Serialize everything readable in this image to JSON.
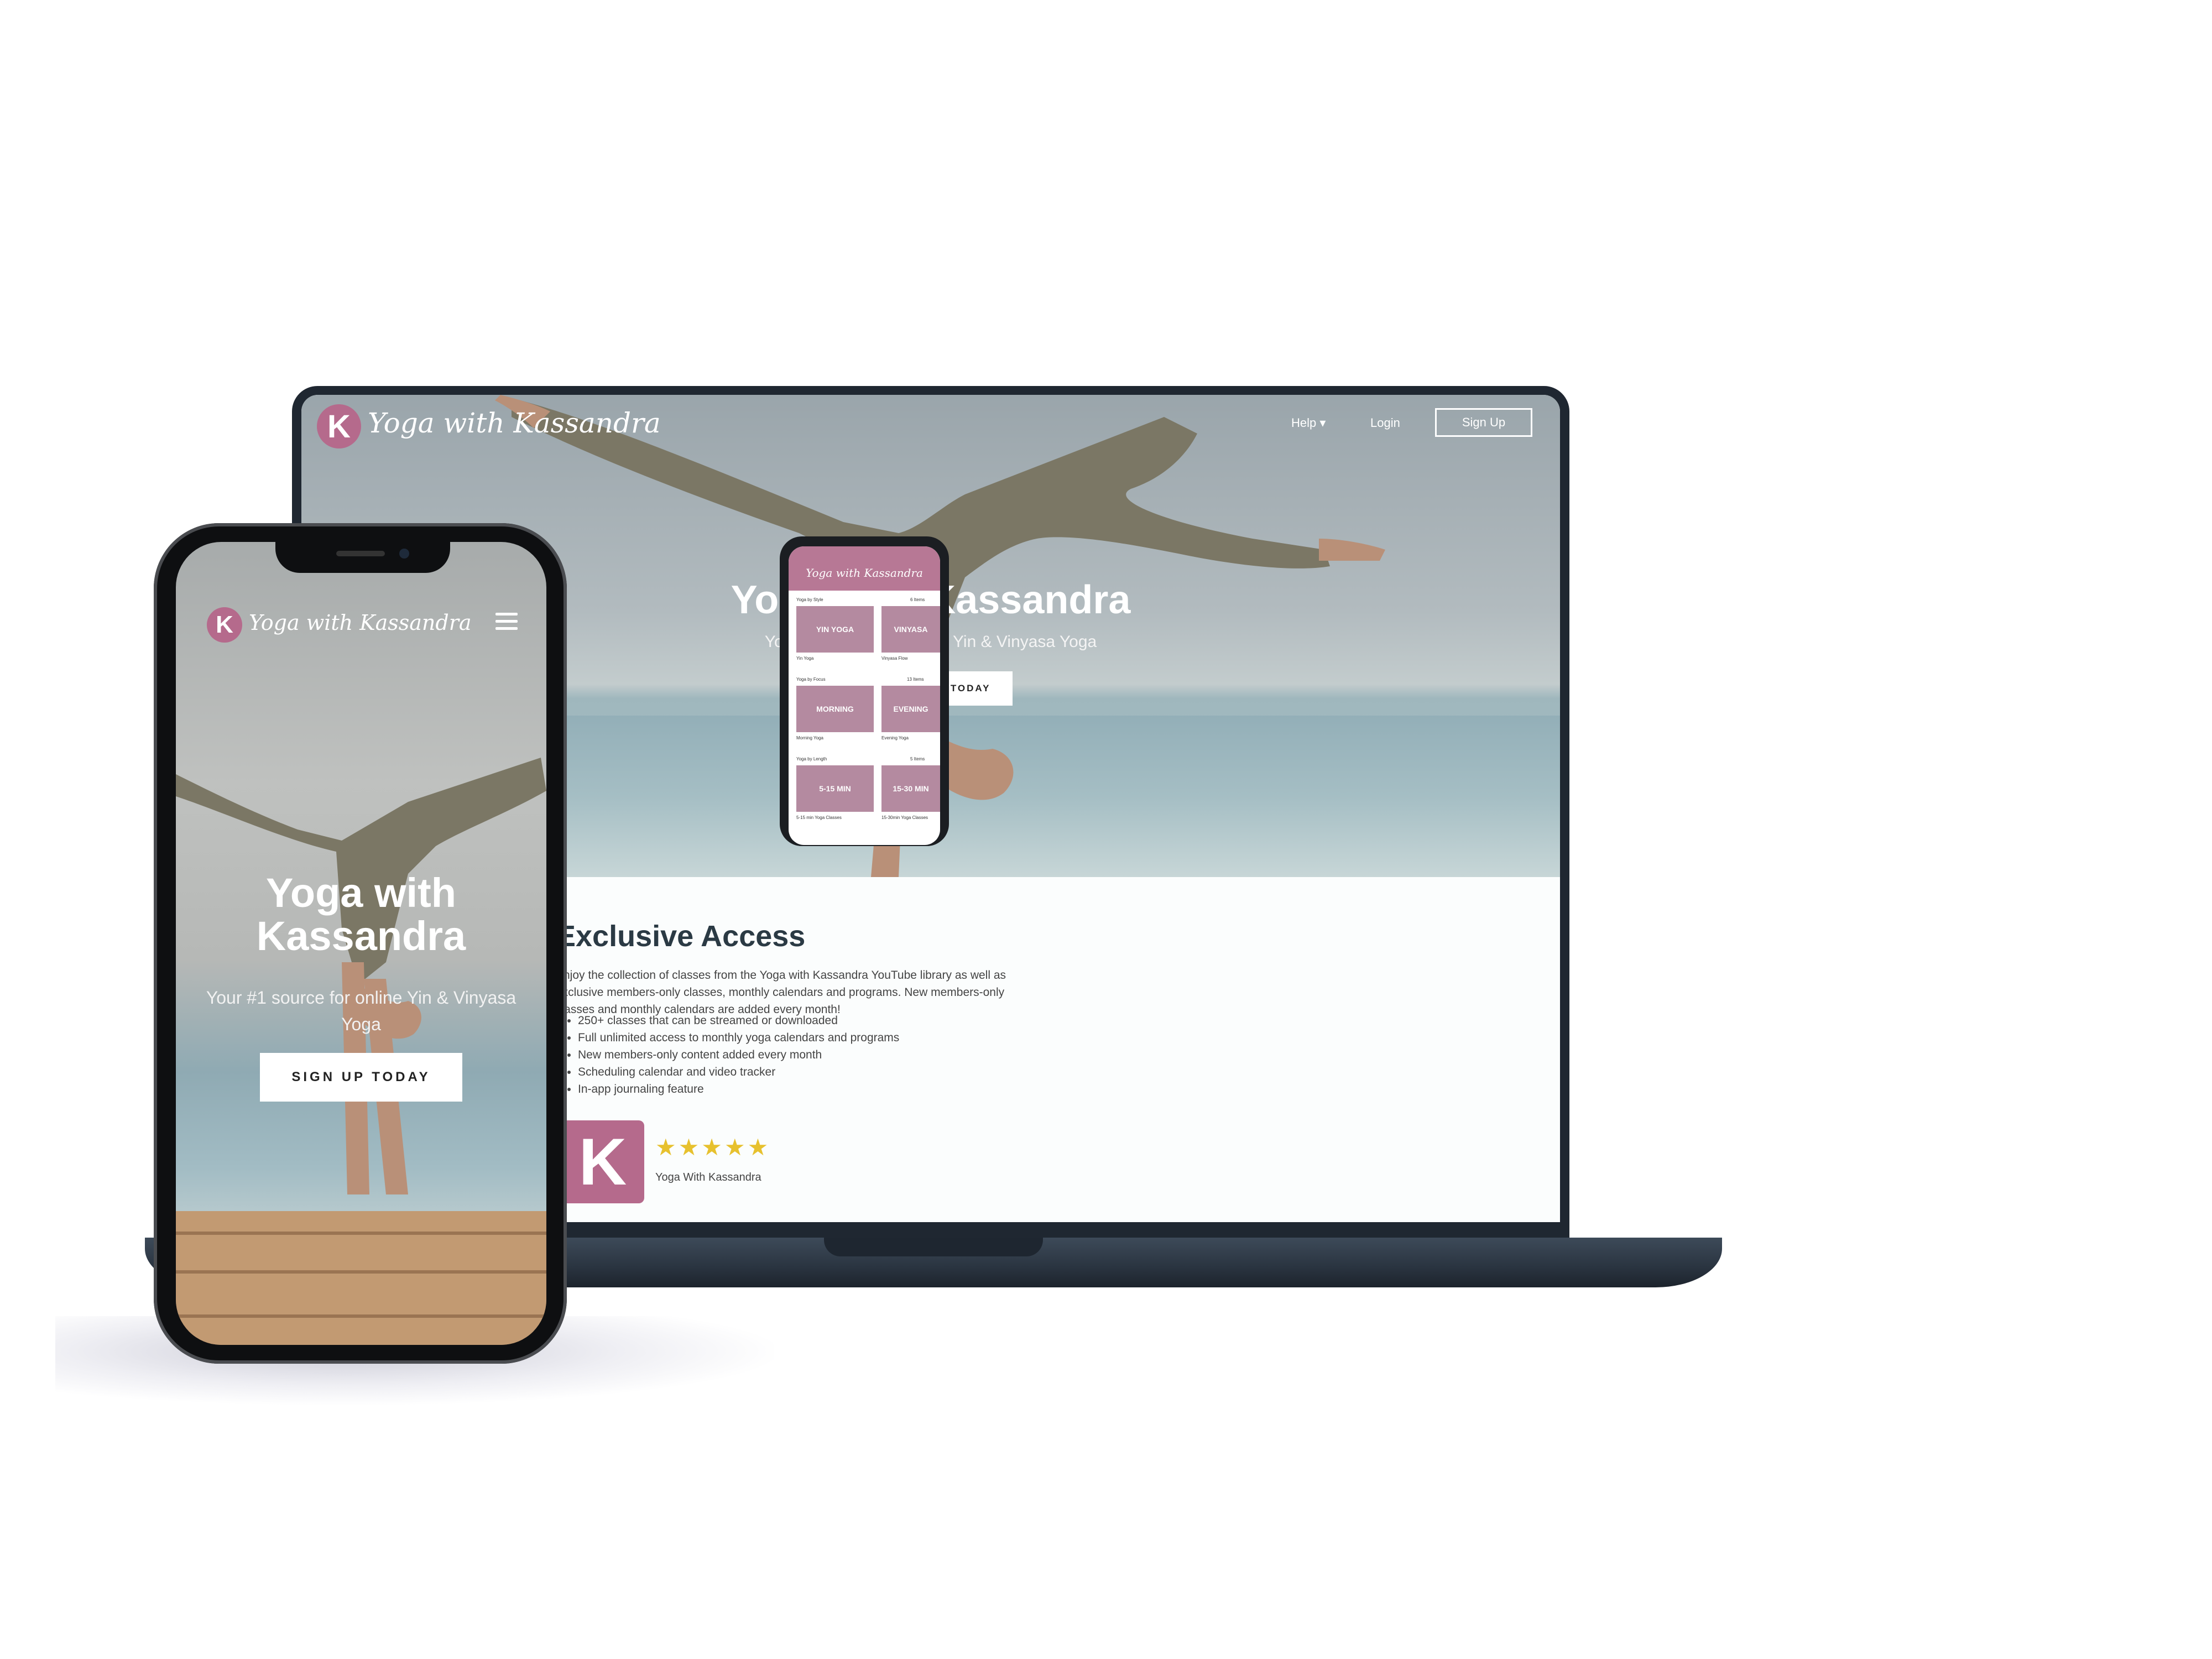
{
  "brand": {
    "logo_letter": "K",
    "name_script": "Yoga with Kassandra",
    "accent_color": "#b56a8c",
    "star_color": "#e7c12e"
  },
  "laptop": {
    "nav": {
      "help": "Help ▾",
      "login": "Login",
      "signup": "Sign Up"
    },
    "hero": {
      "title": "Yoga with Kassandra",
      "subtitle": "Your #1 source for online Yin & Vinyasa Yoga",
      "cta": "SIGN UP TODAY"
    },
    "section": {
      "title": "Exclusive Access",
      "body": "Enjoy the collection of classes from the Yoga with Kassandra YouTube library as well as exclusive members-only classes, monthly calendars and programs. New members-only classes and monthly calendars are added every month!",
      "features": [
        "250+ classes that can be streamed or downloaded",
        "Full unlimited access to monthly yoga calendars and programs",
        "New members-only content added every month",
        "Scheduling calendar and video tracker",
        "In-app journaling feature"
      ],
      "app_stars": "★★★★★",
      "app_name": "Yoga With Kassandra"
    },
    "mini_app": {
      "title": "Yoga with Kassandra",
      "groups": [
        {
          "label": "Yoga by Style",
          "count": "6 Items",
          "thumbs": [
            "YIN YOGA",
            "VINYASA"
          ],
          "captions": [
            "Yin Yoga",
            "Vinyasa Flow"
          ]
        },
        {
          "label": "Yoga by Focus",
          "count": "13 Items",
          "thumbs": [
            "MORNING",
            "EVENING"
          ],
          "captions": [
            "Morning Yoga",
            "Evening Yoga"
          ]
        },
        {
          "label": "Yoga by Length",
          "count": "5 Items",
          "thumbs": [
            "5-15 MIN",
            "15-30 MIN"
          ],
          "captions": [
            "5-15 min Yoga Classes",
            "15-30min Yoga Classes"
          ]
        }
      ]
    }
  },
  "phone": {
    "hero": {
      "title": "Yoga with Kassandra",
      "subtitle": "Your #1 source for online Yin & Vinyasa Yoga",
      "cta": "SIGN UP TODAY"
    },
    "menu_icon": "hamburger-icon"
  }
}
